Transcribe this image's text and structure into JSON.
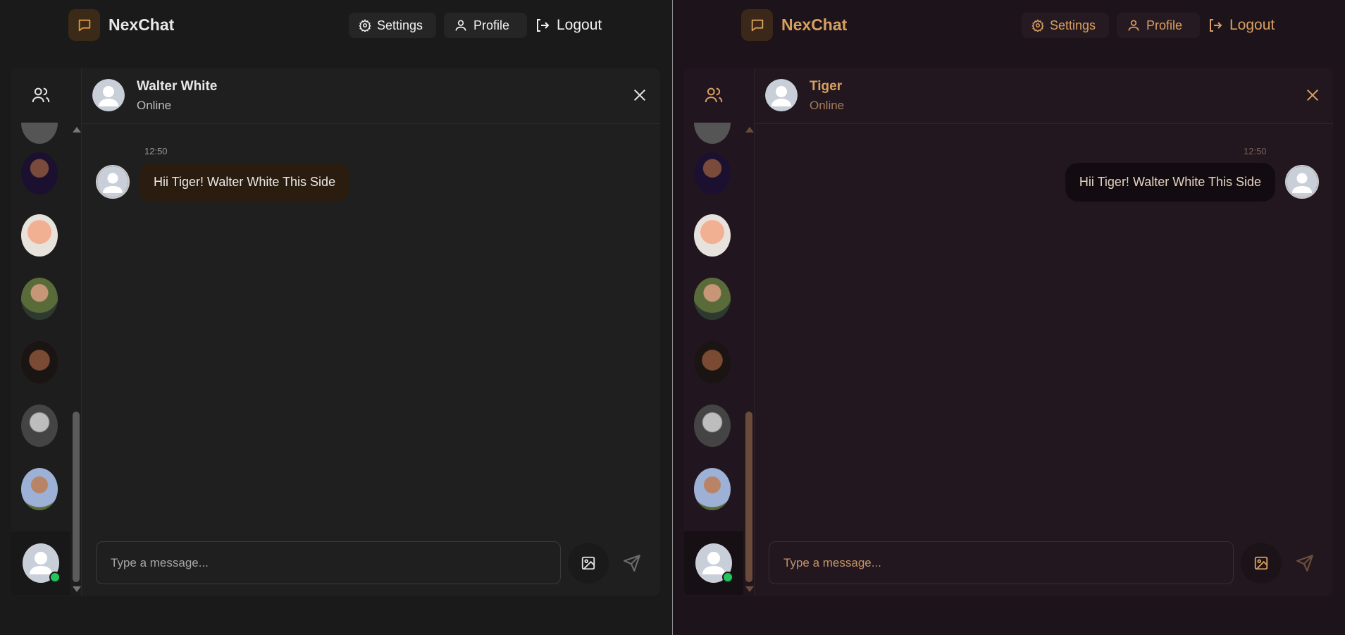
{
  "brand": "NexChat",
  "nav": {
    "settings_label": "Settings",
    "profile_label": "Profile",
    "logout_label": "Logout"
  },
  "panes": [
    {
      "theme": "dark",
      "accent": "#e09a3e",
      "chat_header": {
        "name": "Walter White",
        "status": "Online"
      },
      "message": {
        "time": "12:50",
        "text": "Hii Tiger! Walter White This Side",
        "direction": "incoming"
      },
      "input_placeholder": "Type a message..."
    },
    {
      "theme": "amber",
      "accent": "#d8a060",
      "chat_header": {
        "name": "Tiger",
        "status": "Online"
      },
      "message": {
        "time": "12:50",
        "text": "Hii Tiger! Walter White This Side",
        "direction": "outgoing"
      },
      "input_placeholder": "Type a message..."
    }
  ],
  "contacts": [
    {
      "avatar": "photo-woman-dark-hair"
    },
    {
      "avatar": "photo-man-red-hair-surprised"
    },
    {
      "avatar": "photo-man-striped-shirt"
    },
    {
      "avatar": "photo-bald-man"
    },
    {
      "avatar": "photo-man-black-white"
    },
    {
      "avatar": "photo-man-smiling"
    },
    {
      "avatar": "default-user-avatar",
      "selected": true,
      "online": true
    }
  ]
}
